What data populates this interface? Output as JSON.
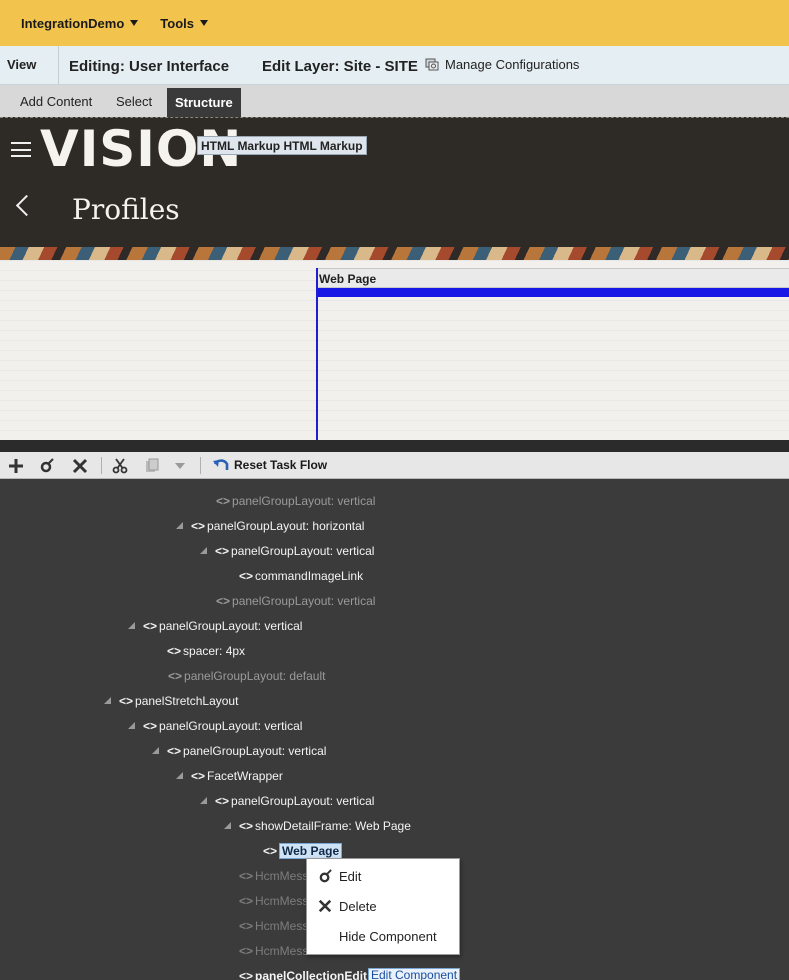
{
  "topbar": {
    "menus": [
      "IntegrationDemo",
      "Tools"
    ]
  },
  "editbar": {
    "view": "View",
    "editing": "Editing: User Interface",
    "edit_layer": "Edit Layer: Site - SITE",
    "manage": "Manage Configurations"
  },
  "tabs": [
    "Add Content",
    "Select",
    "Structure"
  ],
  "brand": {
    "logo": "VISION",
    "markup": "HTML Markup HTML Markup",
    "page_title": "Profiles"
  },
  "preview": {
    "webpage_label": "Web Page"
  },
  "toolbar": {
    "reset": "Reset Task Flow"
  },
  "tree": [
    {
      "label": "panelGroupLayout: vertical"
    },
    {
      "label": "panelGroupLayout: horizontal"
    },
    {
      "label": "panelGroupLayout: vertical"
    },
    {
      "label": "commandImageLink"
    },
    {
      "label": "panelGroupLayout: vertical"
    },
    {
      "label": "panelGroupLayout: vertical"
    },
    {
      "label": "spacer: 4px"
    },
    {
      "label": "panelGroupLayout: default"
    },
    {
      "label": "panelStretchLayout"
    },
    {
      "label": "panelGroupLayout: vertical"
    },
    {
      "label": "panelGroupLayout: vertical"
    },
    {
      "label": "FacetWrapper"
    },
    {
      "label": "panelGroupLayout: vertical"
    },
    {
      "label": "showDetailFrame: Web Page"
    },
    {
      "label": "Web Page"
    },
    {
      "label": "HcmMess"
    },
    {
      "label": "HcmMess"
    },
    {
      "label": "HcmMess"
    },
    {
      "label": "HcmMess"
    },
    {
      "label": "panelCollectionEdit"
    }
  ],
  "context_menu": [
    "Edit",
    "Delete",
    "Hide Component"
  ],
  "edit_component": "Edit Component"
}
